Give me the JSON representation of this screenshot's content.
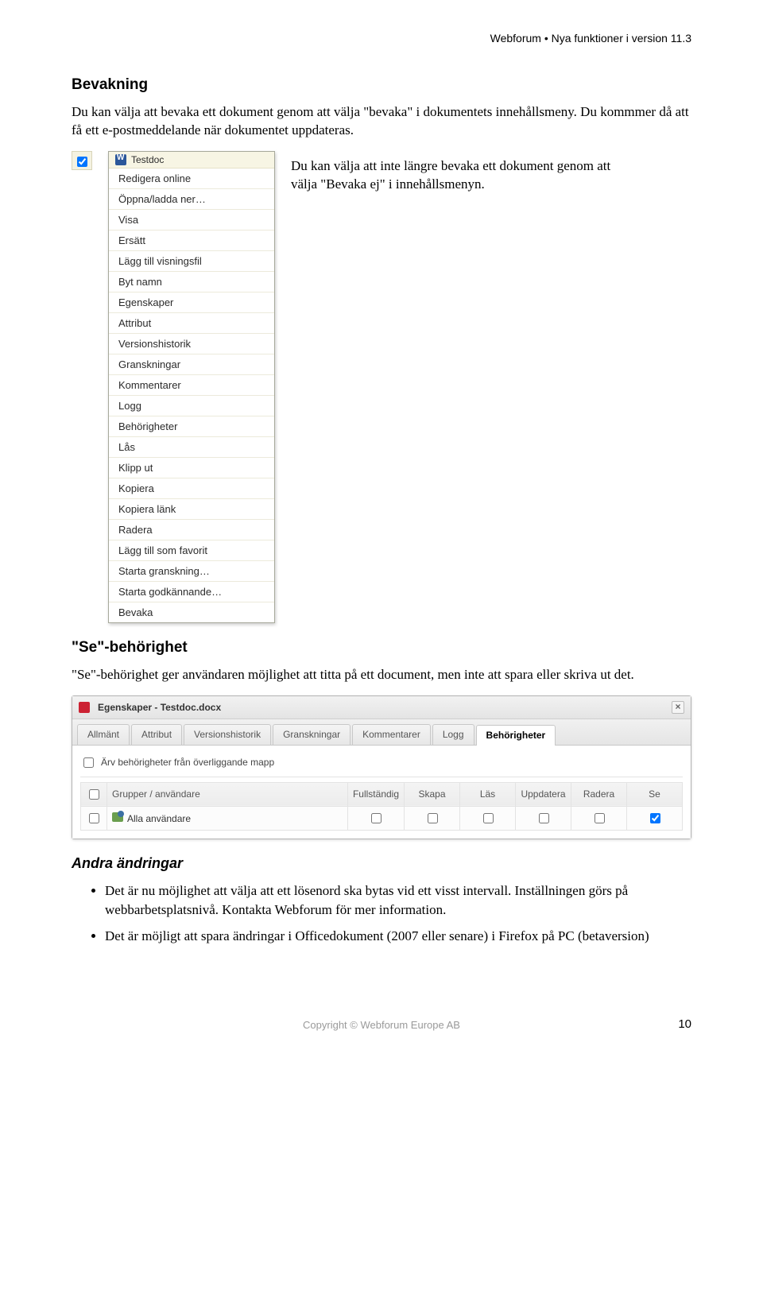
{
  "header": "Webforum • Nya funktioner i version 11.3",
  "section1": {
    "title": "Bevakning",
    "para": "Du kan välja att bevaka ett dokument genom att välja \"bevaka\" i dokumentets innehållsmeny. Du kommmer då att få ett e-postmeddelande när dokumentet uppdateras.",
    "sidenote": "Du kan välja att inte längre bevaka ett dokument genom att välja \"Bevaka ej\" i innehållsmenyn."
  },
  "context_menu": {
    "doc_label": "Testdoc",
    "items": [
      "Redigera online",
      "Öppna/ladda ner…",
      "Visa",
      "Ersätt",
      "Lägg till visningsfil",
      "Byt namn",
      "Egenskaper",
      "Attribut",
      "Versionshistorik",
      "Granskningar",
      "Kommentarer",
      "Logg",
      "Behörigheter",
      "Lås",
      "Klipp ut",
      "Kopiera",
      "Kopiera länk",
      "Radera",
      "Lägg till som favorit",
      "Starta granskning…",
      "Starta godkännande…",
      "Bevaka"
    ]
  },
  "section2": {
    "title": "\"Se\"-behörighet",
    "para": "\"Se\"-behörighet ger användaren möjlighet att titta på ett document, men inte att spara eller skriva ut det."
  },
  "dialog": {
    "title": "Egenskaper - Testdoc.docx",
    "tabs": [
      "Allmänt",
      "Attribut",
      "Versionshistorik",
      "Granskningar",
      "Kommentarer",
      "Logg",
      "Behörigheter"
    ],
    "active_tab": 6,
    "inherit_label": "Ärv behörigheter från överliggande mapp",
    "columns": [
      "Grupper / användare",
      "Fullständig",
      "Skapa",
      "Läs",
      "Uppdatera",
      "Radera",
      "Se"
    ],
    "row": {
      "name": "Alla användare",
      "checks": [
        false,
        false,
        false,
        false,
        false,
        true
      ]
    }
  },
  "section3": {
    "title": "Andra ändringar",
    "bullets": [
      "Det är nu möjlighet att välja att ett lösenord ska bytas vid ett visst intervall. Inställningen görs på webbarbetsplatsnivå. Kontakta Webforum för mer information.",
      "Det är möjligt att spara ändringar i Officedokument (2007 eller senare) i Firefox på PC (betaversion)"
    ]
  },
  "footer": {
    "copyright": "Copyright © Webforum Europe AB",
    "page": "10"
  }
}
